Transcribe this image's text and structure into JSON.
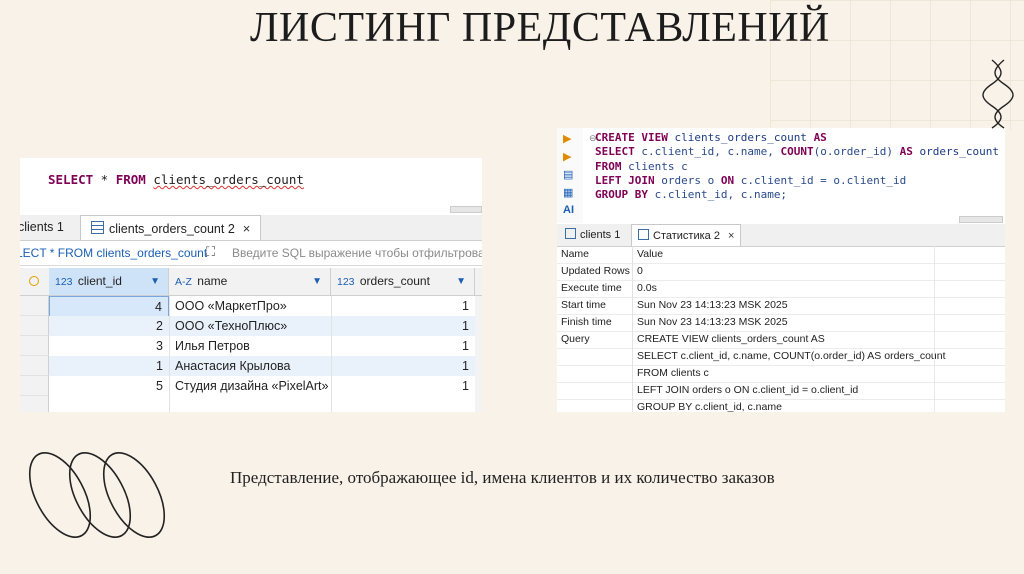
{
  "slide": {
    "title": "ЛИСТИНГ ПРЕДСТАВЛЕНИЙ",
    "caption": "Представление, отображающее id, имена клиентов и их количество заказов"
  },
  "left_screenshot": {
    "sql": {
      "kw_select": "SELECT",
      "star": " * ",
      "kw_from": "FROM",
      "view_name": "clients_orders_count"
    },
    "tabs": [
      {
        "label": "clients 1",
        "active": false
      },
      {
        "label": "clients_orders_count 2",
        "active": true
      }
    ],
    "tab_close": "×",
    "filter": {
      "query_text": "LECT * FROM clients_orders_count",
      "placeholder": "Введите SQL выражение чтобы отфильтровать"
    },
    "columns": [
      {
        "type": "123",
        "name": "client_id"
      },
      {
        "type": "A-Z",
        "name": "name"
      },
      {
        "type": "123",
        "name": "orders_count"
      }
    ],
    "rows": [
      {
        "client_id": "4",
        "name": "ООО «МаркетПро»",
        "orders_count": "1"
      },
      {
        "client_id": "2",
        "name": "ООО «ТехноПлюс»",
        "orders_count": "1"
      },
      {
        "client_id": "3",
        "name": "Илья Петров",
        "orders_count": "1"
      },
      {
        "client_id": "1",
        "name": "Анастасия Крылова",
        "orders_count": "1"
      },
      {
        "client_id": "5",
        "name": "Студия дизайна «PixelArt»",
        "orders_count": "1"
      }
    ]
  },
  "right_screenshot": {
    "code": {
      "l1_kw1": "CREATE VIEW",
      "l1_name": " clients_orders_count ",
      "l1_kw2": "AS",
      "l2_kw": "SELECT",
      "l2_a": " c.client_id, c.name, ",
      "l2_fn": "COUNT",
      "l2_b": "(o.order_id) ",
      "l2_kw2": "AS",
      "l2_c": " orders_count",
      "l3_kw": "FROM",
      "l3_a": " clients c",
      "l4_kw1": "LEFT JOIN",
      "l4_a": " orders o ",
      "l4_kw2": "ON",
      "l4_b": " c.client_id = o.client_id",
      "l5_kw": "GROUP BY",
      "l5_a": " c.client_id, c.name;"
    },
    "gutter_ai": "AI",
    "tabs": [
      {
        "label": "clients 1",
        "active": false
      },
      {
        "label": "Статистика 2",
        "active": true
      }
    ],
    "tab_close": "×",
    "stats_header": {
      "name": "Name",
      "value": "Value"
    },
    "stats": [
      {
        "name": "Updated Rows",
        "value": "0"
      },
      {
        "name": "Execute time",
        "value": "0.0s"
      },
      {
        "name": "Start time",
        "value": "Sun Nov 23 14:13:23 MSK 2025"
      },
      {
        "name": "Finish time",
        "value": "Sun Nov 23 14:13:23 MSK 2025"
      },
      {
        "name": "Query",
        "value": "CREATE VIEW clients_orders_count AS"
      },
      {
        "name": "",
        "value": "SELECT c.client_id, c.name, COUNT(o.order_id) AS orders_count"
      },
      {
        "name": "",
        "value": "FROM clients c"
      },
      {
        "name": "",
        "value": "LEFT JOIN orders o ON c.client_id = o.client_id"
      },
      {
        "name": "",
        "value": "GROUP BY c.client_id, c.name"
      }
    ]
  }
}
